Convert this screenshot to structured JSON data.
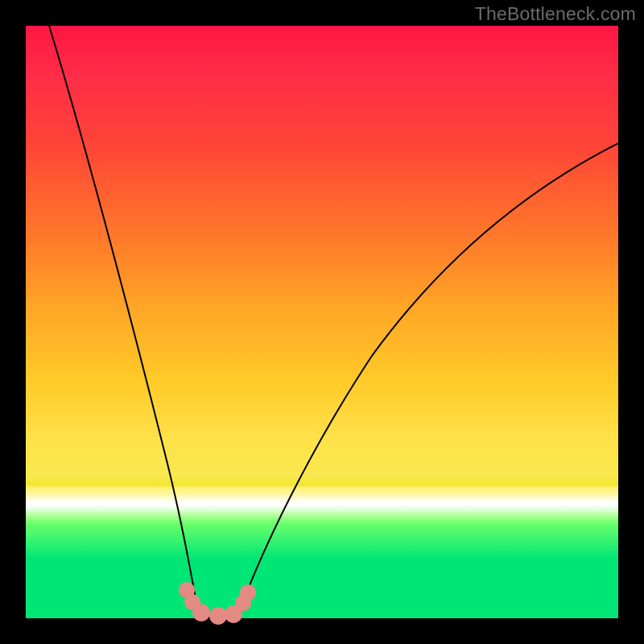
{
  "attribution": "TheBottleneck.com",
  "colors": {
    "page_bg": "#000000",
    "attribution_text": "#6b6b6b",
    "curve_stroke": "#000000",
    "marker_fill": "#e28a83",
    "gradient_stops": [
      "#ff1744",
      "#ff2e47",
      "#ff4437",
      "#ff7a2a",
      "#ffa726",
      "#ffca28",
      "#ffe24a",
      "#f8e84e",
      "#f2e72e",
      "#fff176",
      "#fff59d",
      "#fffde7",
      "#ffffff",
      "#e8ffe8",
      "#b9ff9e",
      "#6aff6a",
      "#00e676"
    ]
  },
  "chart_data": {
    "type": "line",
    "title": "",
    "xlabel": "",
    "ylabel": "",
    "x_range": [
      0,
      100
    ],
    "y_range": [
      0,
      100
    ],
    "series": [
      {
        "name": "left-branch",
        "x": [
          4,
          10,
          15,
          20,
          23,
          25,
          26.5,
          27.5,
          28,
          29
        ],
        "y": [
          100,
          70,
          45,
          24,
          12,
          5,
          1.5,
          0.5,
          0.2,
          0
        ]
      },
      {
        "name": "valley-floor",
        "x": [
          29,
          30,
          31,
          32,
          33,
          34,
          35
        ],
        "y": [
          0,
          0,
          0,
          0,
          0,
          0,
          0
        ]
      },
      {
        "name": "right-branch",
        "x": [
          35,
          36,
          38,
          42,
          48,
          56,
          66,
          78,
          90,
          100
        ],
        "y": [
          0,
          0.6,
          3,
          10,
          22,
          37,
          52,
          65,
          74,
          80
        ]
      }
    ],
    "markers": [
      {
        "name": "left-descent-marker-a",
        "x": 27.0,
        "y": 3.5
      },
      {
        "name": "left-descent-marker-b",
        "x": 28.0,
        "y": 1.5
      },
      {
        "name": "valley-floor-marker-a",
        "x": 30.0,
        "y": 0.2
      },
      {
        "name": "valley-floor-marker-b",
        "x": 32.5,
        "y": 0.0
      },
      {
        "name": "valley-floor-marker-c",
        "x": 35.0,
        "y": 0.3
      },
      {
        "name": "right-ascent-marker-a",
        "x": 36.5,
        "y": 2.0
      },
      {
        "name": "right-ascent-marker-b",
        "x": 37.3,
        "y": 3.8
      }
    ],
    "marker_radius_percent": 1.3,
    "notes": "y values are percentages of the inner plot height measured from the bottom (green) toward the top (red). The curve is a V whose minimum sits near x≈29–35 at y≈0."
  }
}
